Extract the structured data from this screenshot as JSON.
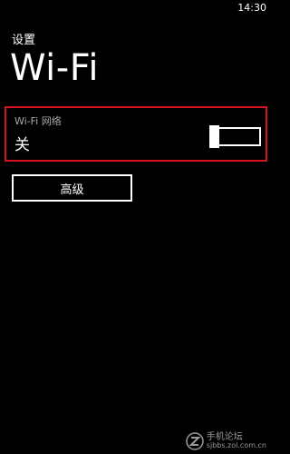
{
  "status_bar": {
    "time": "14:30"
  },
  "header": {
    "app_label": "设置",
    "title": "Wi-Fi"
  },
  "wifi_network": {
    "label": "Wi-Fi 网络",
    "state": "关",
    "toggle_on": false
  },
  "advanced_button": {
    "label": "高级"
  },
  "watermark": {
    "line1": "手机论坛",
    "line2": "sjbbs.zol.com.cn",
    "logo_icon": "zol-logo-icon"
  },
  "colors": {
    "background": "#000000",
    "foreground": "#ffffff",
    "highlight_border": "#d6101d",
    "secondary_text": "#a9a9a9"
  }
}
